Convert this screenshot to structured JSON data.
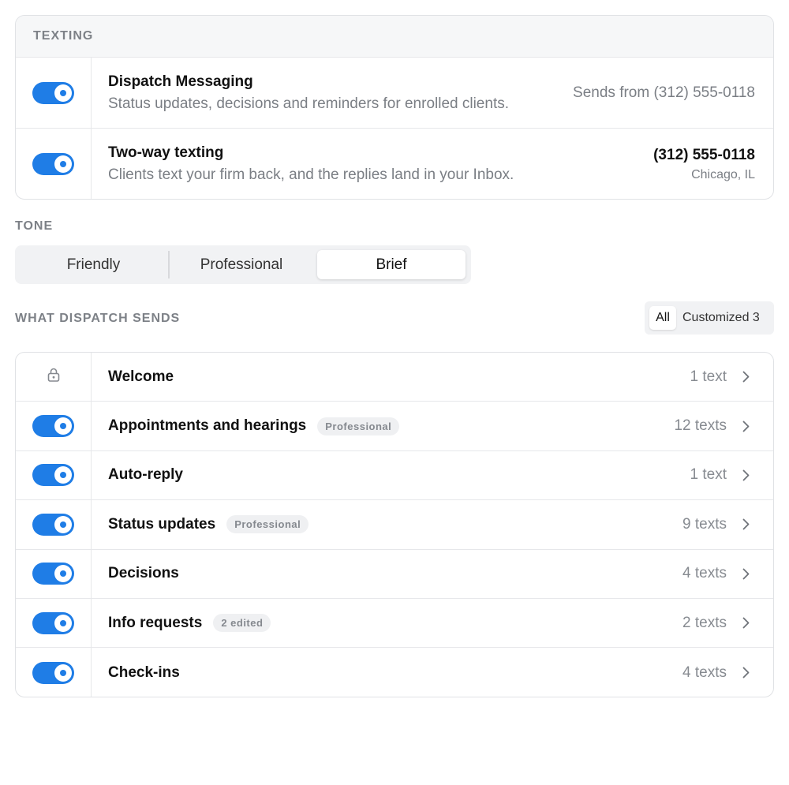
{
  "texting": {
    "section_label": "TEXTING",
    "rows": [
      {
        "title": "Dispatch Messaging",
        "subtitle": "Status updates, decisions and reminders for enrolled clients.",
        "right_text": "Sends from (312) 555-0118",
        "enabled": true
      },
      {
        "title": "Two-way texting",
        "subtitle": "Clients text your firm back, and the replies land in your Inbox.",
        "phone": "(312) 555-0118",
        "location": "Chicago, IL",
        "enabled": true
      }
    ]
  },
  "tone": {
    "section_label": "TONE",
    "options": [
      "Friendly",
      "Professional",
      "Brief"
    ],
    "selected": "Brief"
  },
  "sends": {
    "section_label": "WHAT DISPATCH SENDS",
    "filter": {
      "all_label": "All",
      "customized_label": "Customized 3",
      "selected": "All"
    },
    "items": [
      {
        "title": "Welcome",
        "count": "1 text",
        "locked": true
      },
      {
        "title": "Appointments and hearings",
        "badge": "Professional",
        "count": "12 texts",
        "enabled": true
      },
      {
        "title": "Auto-reply",
        "count": "1 text",
        "enabled": true
      },
      {
        "title": "Status updates",
        "badge": "Professional",
        "count": "9 texts",
        "enabled": true
      },
      {
        "title": "Decisions",
        "count": "4 texts",
        "enabled": true
      },
      {
        "title": "Info requests",
        "badge": "2 edited",
        "count": "2 texts",
        "enabled": true
      },
      {
        "title": "Check-ins",
        "count": "4 texts",
        "enabled": true
      }
    ]
  },
  "colors": {
    "accent": "#1f7de6",
    "muted_text": "#7a7e84",
    "border": "#e0e2e5"
  },
  "icons": {
    "lock": "lock-icon",
    "chevron": "chevron-right-icon"
  }
}
